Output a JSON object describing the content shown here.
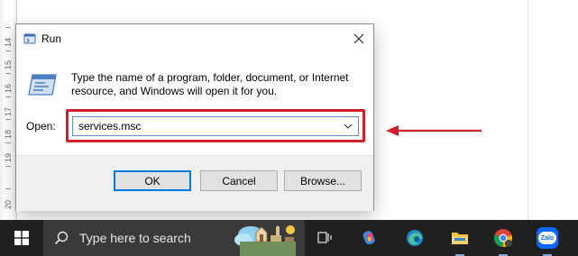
{
  "ruler": {
    "numbers": [
      "14",
      "15",
      "16",
      "17",
      "18",
      "19",
      "20"
    ]
  },
  "dialog": {
    "title": "Run",
    "close_icon": "close-icon",
    "description": "Type the name of a program, folder, document, or Internet resource, and Windows will open it for you.",
    "open_label": "Open:",
    "open_value": "services.msc",
    "buttons": {
      "ok": "OK",
      "cancel": "Cancel",
      "browse": "Browse..."
    }
  },
  "annotation": {
    "highlight_color": "#d1202b",
    "arrow_color": "#d1202b"
  },
  "taskbar": {
    "search_placeholder": "Type here to search",
    "apps": [
      "windows-start-icon",
      "search-icon",
      "news-weather-widget",
      "task-view-icon",
      "copilot-icon",
      "edge-icon",
      "file-explorer-icon",
      "chrome-icon",
      "zalo-icon"
    ],
    "zalo_label": "Zalo"
  }
}
